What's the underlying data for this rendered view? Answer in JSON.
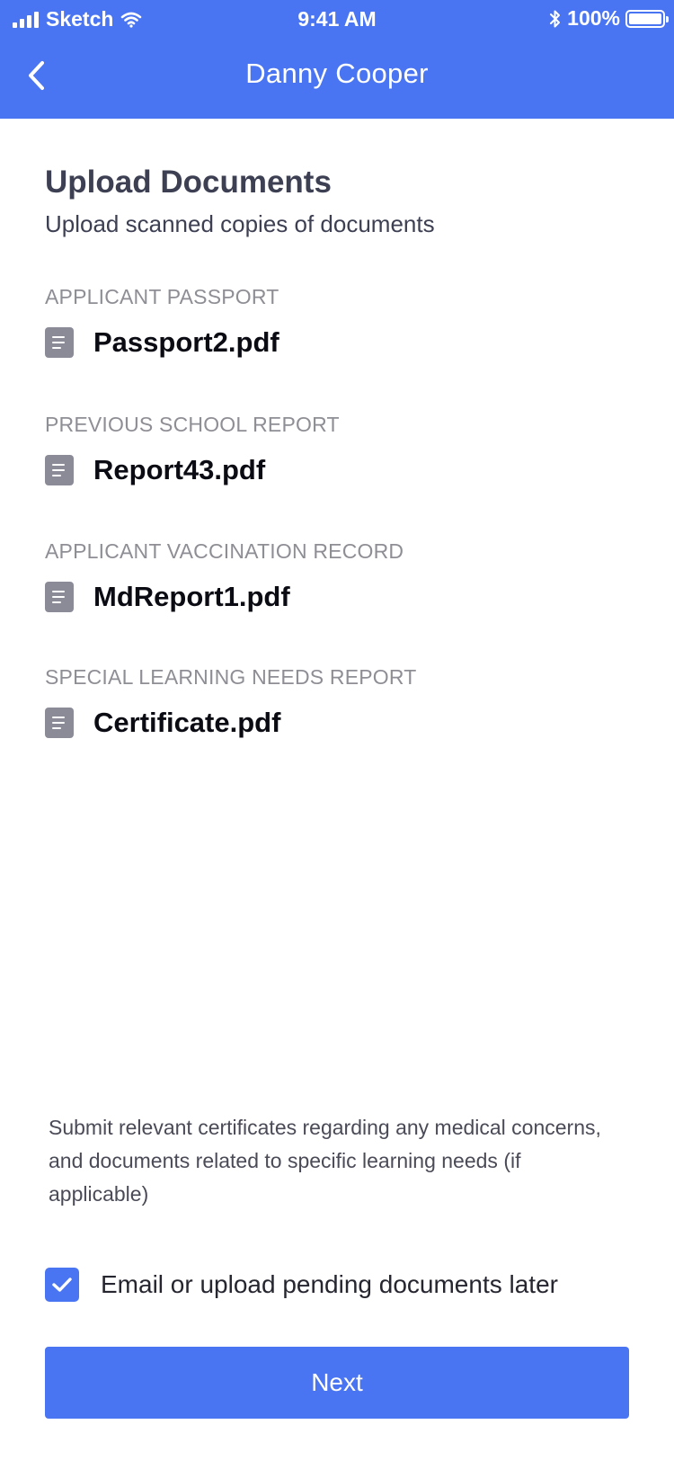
{
  "status_bar": {
    "carrier": "Sketch",
    "time": "9:41 AM",
    "battery": "100%"
  },
  "nav": {
    "title": "Danny Cooper",
    "back_icon": "chevron-left-icon"
  },
  "page": {
    "title": "Upload Documents",
    "subtitle": "Upload scanned copies of documents"
  },
  "documents": [
    {
      "label": "APPLICANT PASSPORT",
      "filename": "Passport2.pdf",
      "icon": "document-icon"
    },
    {
      "label": "PREVIOUS SCHOOL REPORT",
      "filename": "Report43.pdf",
      "icon": "document-icon"
    },
    {
      "label": "APPLICANT VACCINATION RECORD",
      "filename": "MdReport1.pdf",
      "icon": "document-icon"
    },
    {
      "label": "SPECIAL LEARNING NEEDS REPORT",
      "filename": "Certificate.pdf",
      "icon": "document-icon"
    }
  ],
  "note": "Submit relevant certificates regarding any medical concerns, and documents related to specific learning needs (if applicable)",
  "pending_option": {
    "label": "Email or upload pending documents later",
    "checked": true
  },
  "next_label": "Next",
  "colors": {
    "accent": "#4A75F2",
    "label_gray": "#8E8E95",
    "icon_gray": "#8A8B96"
  }
}
